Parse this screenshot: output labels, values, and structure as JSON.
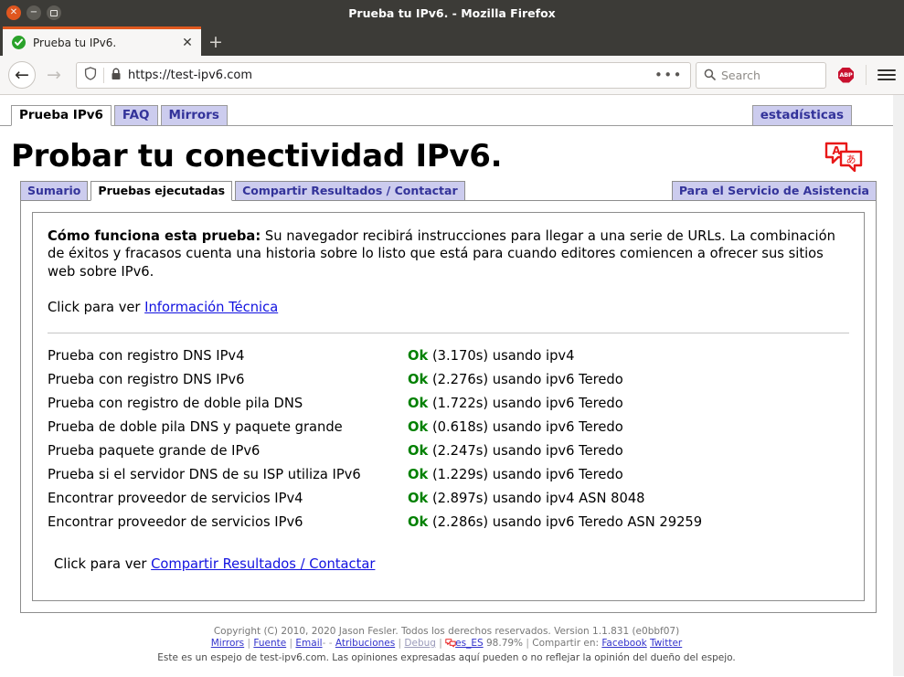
{
  "window": {
    "title": "Prueba tu IPv6. - Mozilla Firefox",
    "close_icon": "window-close-icon",
    "minimize_icon": "window-minimize-icon",
    "maximize_icon": "window-maximize-icon"
  },
  "browser": {
    "tab": {
      "title": "Prueba tu IPv6.",
      "favicon": "green-check-favicon",
      "close_label": "✕"
    },
    "newtab_label": "+",
    "back_label": "←",
    "forward_label": "→",
    "shield_icon": "tracking-protection-shield-icon",
    "lock_icon": "padlock-icon",
    "url": "https://test-ipv6.com",
    "page_actions_label": "•••",
    "search_placeholder": "Search",
    "search_icon": "magnifier-icon",
    "abp_label": "ABP",
    "menu_icon": "hamburger-menu-icon"
  },
  "site_nav": {
    "tabs": [
      {
        "label": "Prueba IPv6",
        "active": true
      },
      {
        "label": "FAQ",
        "active": false
      },
      {
        "label": "Mirrors",
        "active": false
      }
    ],
    "stats_label": "estadísticas"
  },
  "page": {
    "title": "Probar tu conectividad IPv6.",
    "translate_icon": "translate-speech-bubbles-icon",
    "translate_letter_a": "A",
    "translate_letter_jp": "あ"
  },
  "inner_tabs": {
    "tabs": [
      {
        "label": "Sumario",
        "active": false
      },
      {
        "label": "Pruebas ejecutadas",
        "active": true
      },
      {
        "label": "Compartir Resultados / Contactar",
        "active": false
      }
    ],
    "support_label": "Para el Servicio de Asistencia"
  },
  "intro": {
    "heading": "Cómo funciona esta prueba:",
    "body": " Su navegador recibirá instrucciones para llegar a una serie de URLs. La combinación de éxitos y fracasos cuenta una historia sobre lo listo que está para cuando editores comiencen a ofrecer sus sitios web sobre IPv6.",
    "click_prefix": "Click para ver ",
    "tech_link": "Información Técnica"
  },
  "results": {
    "rows": [
      {
        "name": "Prueba con registro DNS IPv4",
        "status": "Ok",
        "detail": "(3.170s) usando ipv4"
      },
      {
        "name": "Prueba con registro DNS IPv6",
        "status": "Ok",
        "detail": "(2.276s) usando ipv6 Teredo"
      },
      {
        "name": "Prueba con registro de doble pila DNS",
        "status": "Ok",
        "detail": "(1.722s) usando ipv6 Teredo"
      },
      {
        "name": "Prueba de doble pila DNS y paquete grande",
        "status": "Ok",
        "detail": "(0.618s) usando ipv6 Teredo"
      },
      {
        "name": "Prueba paquete grande de IPv6",
        "status": "Ok",
        "detail": "(2.247s) usando ipv6 Teredo"
      },
      {
        "name": "Prueba si el servidor DNS de su ISP utiliza IPv6",
        "status": "Ok",
        "detail": "(1.229s) usando ipv6 Teredo"
      },
      {
        "name": "Encontrar proveedor de servicios IPv4",
        "status": "Ok",
        "detail": "(2.897s) usando ipv4 ASN 8048"
      },
      {
        "name": "Encontrar proveedor de servicios IPv6",
        "status": "Ok",
        "detail": "(2.286s) usando ipv6 Teredo ASN 29259"
      }
    ],
    "bottom_click_prefix": "Click para ver ",
    "bottom_link": "Compartir Resultados / Contactar"
  },
  "footer": {
    "copyright": "Copyright (C) 2010, 2020 Jason Fesler. Todos los derechos reservados. Version 1.1.831 (e0bbf07)",
    "links": {
      "mirrors": "Mirrors",
      "fuente": "Fuente",
      "email": "Email",
      "dash": "-    -",
      "atribuciones": "Atribuciones",
      "debug": "Debug",
      "locale": "es_ES",
      "percent": "98.79%",
      "share_label": "Compartir en:",
      "facebook": "Facebook",
      "twitter": "Twitter"
    },
    "mirror_notice": "Este es un espejo de test-ipv6.com. Las opiniones expresadas aquí pueden o no reflejar la opinión del dueño del espejo."
  },
  "colors": {
    "ok_green": "#008000",
    "link_blue": "#1212e0",
    "tab_lavender": "#ccccee",
    "tab_text_blue": "#33339a",
    "firefox_orange": "#e0591f",
    "titlebar": "#3c3b37"
  }
}
